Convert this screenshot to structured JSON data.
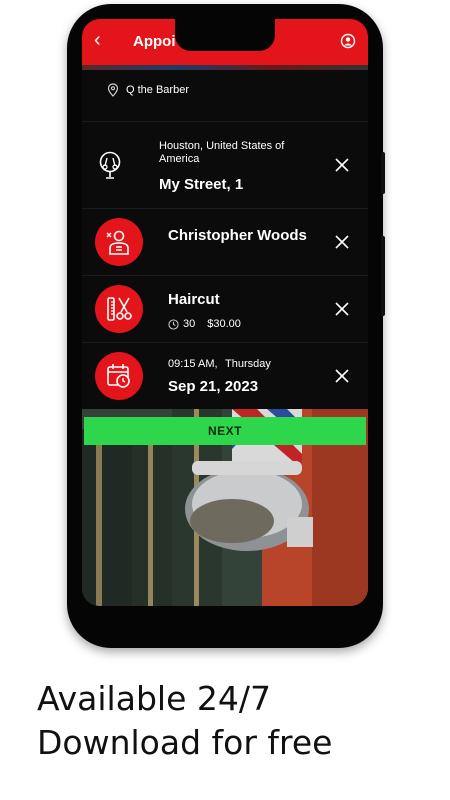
{
  "topbar": {
    "back_icon": "chevron-left-icon",
    "title": "Appoi",
    "user_icon": "user-circle-icon"
  },
  "shop": {
    "name": "Q the Barber",
    "icon": "map-pin-icon"
  },
  "location": {
    "city": "Houston, United States of America",
    "street": "My Street, 1",
    "icon": "barber-shop-icon"
  },
  "staff": {
    "name": "Christopher Woods",
    "icon": "barber-person-icon"
  },
  "service": {
    "name": "Haircut",
    "duration": "30",
    "price": "$30.00",
    "icon": "comb-scissors-icon"
  },
  "appointment": {
    "time": "09:15 AM,",
    "weekday": "Thursday",
    "date": "Sep 21, 2023",
    "icon": "calendar-clock-icon"
  },
  "next_button": "NEXT",
  "tagline": {
    "line1": "Available 24/7",
    "line2": "Download for free"
  },
  "colors": {
    "accent": "#e4141b",
    "next": "#2ed64b",
    "screen_bg": "#0b0b0b"
  }
}
